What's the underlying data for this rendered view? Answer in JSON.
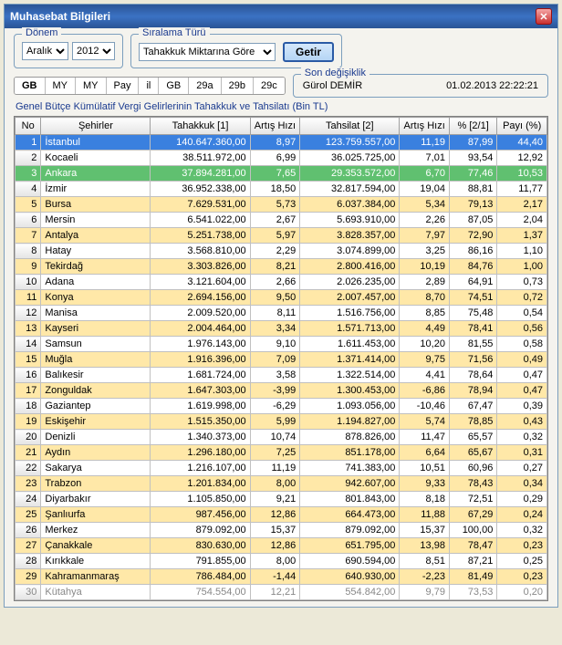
{
  "window": {
    "title": "Muhasebat Bilgileri"
  },
  "donem": {
    "legend": "Dönem",
    "month": "Aralık",
    "year": "2012"
  },
  "siralama": {
    "legend": "Sıralama Türü",
    "value": "Tahakkuk Miktarına Göre"
  },
  "buttons": {
    "getir": "Getir"
  },
  "tabs": [
    "GB",
    "MY",
    "MY",
    "Pay",
    "il",
    "GB",
    "29a",
    "29b",
    "29c"
  ],
  "active_tab_index": 0,
  "sondeg": {
    "legend": "Son değişiklik",
    "user": "Gürol DEMİR",
    "datetime": "01.02.2013 22:22:21"
  },
  "table": {
    "caption": "Genel Bütçe Kümülatif Vergi Gelirlerinin Tahakkuk ve Tahsilatı (Bin TL)",
    "columns": [
      "No",
      "Şehirler",
      "Tahakkuk [1]",
      "Artış Hızı",
      "Tahsilat [2]",
      "Artış Hızı",
      "% [2/1]",
      "Payı (%)"
    ],
    "rows": [
      {
        "no": 1,
        "sehir": "İstanbul",
        "tahakkuk": "140.647.360,00",
        "ah1": "8,97",
        "tahsilat": "123.759.557,00",
        "ah2": "11,19",
        "pct": "87,99",
        "pay": "44,40",
        "cls": "selected"
      },
      {
        "no": 2,
        "sehir": "Kocaeli",
        "tahakkuk": "38.511.972,00",
        "ah1": "6,99",
        "tahsilat": "36.025.725,00",
        "ah2": "7,01",
        "pct": "93,54",
        "pay": "12,92",
        "cls": "odd"
      },
      {
        "no": 3,
        "sehir": "Ankara",
        "tahakkuk": "37.894.281,00",
        "ah1": "7,65",
        "tahsilat": "29.353.572,00",
        "ah2": "6,70",
        "pct": "77,46",
        "pay": "10,53",
        "cls": "green"
      },
      {
        "no": 4,
        "sehir": "İzmir",
        "tahakkuk": "36.952.338,00",
        "ah1": "18,50",
        "tahsilat": "32.817.594,00",
        "ah2": "19,04",
        "pct": "88,81",
        "pay": "11,77",
        "cls": "odd"
      },
      {
        "no": 5,
        "sehir": "Bursa",
        "tahakkuk": "7.629.531,00",
        "ah1": "5,73",
        "tahsilat": "6.037.384,00",
        "ah2": "5,34",
        "pct": "79,13",
        "pay": "2,17",
        "cls": "highlight"
      },
      {
        "no": 6,
        "sehir": "Mersin",
        "tahakkuk": "6.541.022,00",
        "ah1": "2,67",
        "tahsilat": "5.693.910,00",
        "ah2": "2,26",
        "pct": "87,05",
        "pay": "2,04",
        "cls": "odd"
      },
      {
        "no": 7,
        "sehir": "Antalya",
        "tahakkuk": "5.251.738,00",
        "ah1": "5,97",
        "tahsilat": "3.828.357,00",
        "ah2": "7,97",
        "pct": "72,90",
        "pay": "1,37",
        "cls": "highlight"
      },
      {
        "no": 8,
        "sehir": "Hatay",
        "tahakkuk": "3.568.810,00",
        "ah1": "2,29",
        "tahsilat": "3.074.899,00",
        "ah2": "3,25",
        "pct": "86,16",
        "pay": "1,10",
        "cls": "odd"
      },
      {
        "no": 9,
        "sehir": "Tekirdağ",
        "tahakkuk": "3.303.826,00",
        "ah1": "8,21",
        "tahsilat": "2.800.416,00",
        "ah2": "10,19",
        "pct": "84,76",
        "pay": "1,00",
        "cls": "highlight"
      },
      {
        "no": 10,
        "sehir": "Adana",
        "tahakkuk": "3.121.604,00",
        "ah1": "2,66",
        "tahsilat": "2.026.235,00",
        "ah2": "2,89",
        "pct": "64,91",
        "pay": "0,73",
        "cls": "odd"
      },
      {
        "no": 11,
        "sehir": "Konya",
        "tahakkuk": "2.694.156,00",
        "ah1": "9,50",
        "tahsilat": "2.007.457,00",
        "ah2": "8,70",
        "pct": "74,51",
        "pay": "0,72",
        "cls": "highlight"
      },
      {
        "no": 12,
        "sehir": "Manisa",
        "tahakkuk": "2.009.520,00",
        "ah1": "8,11",
        "tahsilat": "1.516.756,00",
        "ah2": "8,85",
        "pct": "75,48",
        "pay": "0,54",
        "cls": "odd"
      },
      {
        "no": 13,
        "sehir": "Kayseri",
        "tahakkuk": "2.004.464,00",
        "ah1": "3,34",
        "tahsilat": "1.571.713,00",
        "ah2": "4,49",
        "pct": "78,41",
        "pay": "0,56",
        "cls": "highlight"
      },
      {
        "no": 14,
        "sehir": "Samsun",
        "tahakkuk": "1.976.143,00",
        "ah1": "9,10",
        "tahsilat": "1.611.453,00",
        "ah2": "10,20",
        "pct": "81,55",
        "pay": "0,58",
        "cls": "odd"
      },
      {
        "no": 15,
        "sehir": "Muğla",
        "tahakkuk": "1.916.396,00",
        "ah1": "7,09",
        "tahsilat": "1.371.414,00",
        "ah2": "9,75",
        "pct": "71,56",
        "pay": "0,49",
        "cls": "highlight"
      },
      {
        "no": 16,
        "sehir": "Balıkesir",
        "tahakkuk": "1.681.724,00",
        "ah1": "3,58",
        "tahsilat": "1.322.514,00",
        "ah2": "4,41",
        "pct": "78,64",
        "pay": "0,47",
        "cls": "odd"
      },
      {
        "no": 17,
        "sehir": "Zonguldak",
        "tahakkuk": "1.647.303,00",
        "ah1": "-3,99",
        "tahsilat": "1.300.453,00",
        "ah2": "-6,86",
        "pct": "78,94",
        "pay": "0,47",
        "cls": "highlight"
      },
      {
        "no": 18,
        "sehir": "Gaziantep",
        "tahakkuk": "1.619.998,00",
        "ah1": "-6,29",
        "tahsilat": "1.093.056,00",
        "ah2": "-10,46",
        "pct": "67,47",
        "pay": "0,39",
        "cls": "odd"
      },
      {
        "no": 19,
        "sehir": "Eskişehir",
        "tahakkuk": "1.515.350,00",
        "ah1": "5,99",
        "tahsilat": "1.194.827,00",
        "ah2": "5,74",
        "pct": "78,85",
        "pay": "0,43",
        "cls": "highlight"
      },
      {
        "no": 20,
        "sehir": "Denizli",
        "tahakkuk": "1.340.373,00",
        "ah1": "10,74",
        "tahsilat": "878.826,00",
        "ah2": "11,47",
        "pct": "65,57",
        "pay": "0,32",
        "cls": "odd"
      },
      {
        "no": 21,
        "sehir": "Aydın",
        "tahakkuk": "1.296.180,00",
        "ah1": "7,25",
        "tahsilat": "851.178,00",
        "ah2": "6,64",
        "pct": "65,67",
        "pay": "0,31",
        "cls": "highlight"
      },
      {
        "no": 22,
        "sehir": "Sakarya",
        "tahakkuk": "1.216.107,00",
        "ah1": "11,19",
        "tahsilat": "741.383,00",
        "ah2": "10,51",
        "pct": "60,96",
        "pay": "0,27",
        "cls": "odd"
      },
      {
        "no": 23,
        "sehir": "Trabzon",
        "tahakkuk": "1.201.834,00",
        "ah1": "8,00",
        "tahsilat": "942.607,00",
        "ah2": "9,33",
        "pct": "78,43",
        "pay": "0,34",
        "cls": "highlight"
      },
      {
        "no": 24,
        "sehir": "Diyarbakır",
        "tahakkuk": "1.105.850,00",
        "ah1": "9,21",
        "tahsilat": "801.843,00",
        "ah2": "8,18",
        "pct": "72,51",
        "pay": "0,29",
        "cls": "odd"
      },
      {
        "no": 25,
        "sehir": "Şanlıurfa",
        "tahakkuk": "987.456,00",
        "ah1": "12,86",
        "tahsilat": "664.473,00",
        "ah2": "11,88",
        "pct": "67,29",
        "pay": "0,24",
        "cls": "highlight"
      },
      {
        "no": 26,
        "sehir": "Merkez",
        "tahakkuk": "879.092,00",
        "ah1": "15,37",
        "tahsilat": "879.092,00",
        "ah2": "15,37",
        "pct": "100,00",
        "pay": "0,32",
        "cls": "odd"
      },
      {
        "no": 27,
        "sehir": "Çanakkale",
        "tahakkuk": "830.630,00",
        "ah1": "12,86",
        "tahsilat": "651.795,00",
        "ah2": "13,98",
        "pct": "78,47",
        "pay": "0,23",
        "cls": "highlight"
      },
      {
        "no": 28,
        "sehir": "Kırıkkale",
        "tahakkuk": "791.855,00",
        "ah1": "8,00",
        "tahsilat": "690.594,00",
        "ah2": "8,51",
        "pct": "87,21",
        "pay": "0,25",
        "cls": "odd"
      },
      {
        "no": 29,
        "sehir": "Kahramanmaraş",
        "tahakkuk": "786.484,00",
        "ah1": "-1,44",
        "tahsilat": "640.930,00",
        "ah2": "-2,23",
        "pct": "81,49",
        "pay": "0,23",
        "cls": "highlight"
      },
      {
        "no": 30,
        "sehir": "Kütahya",
        "tahakkuk": "754.554,00",
        "ah1": "12,21",
        "tahsilat": "554.842,00",
        "ah2": "9,79",
        "pct": "73,53",
        "pay": "0,20",
        "cls": "last"
      }
    ]
  }
}
